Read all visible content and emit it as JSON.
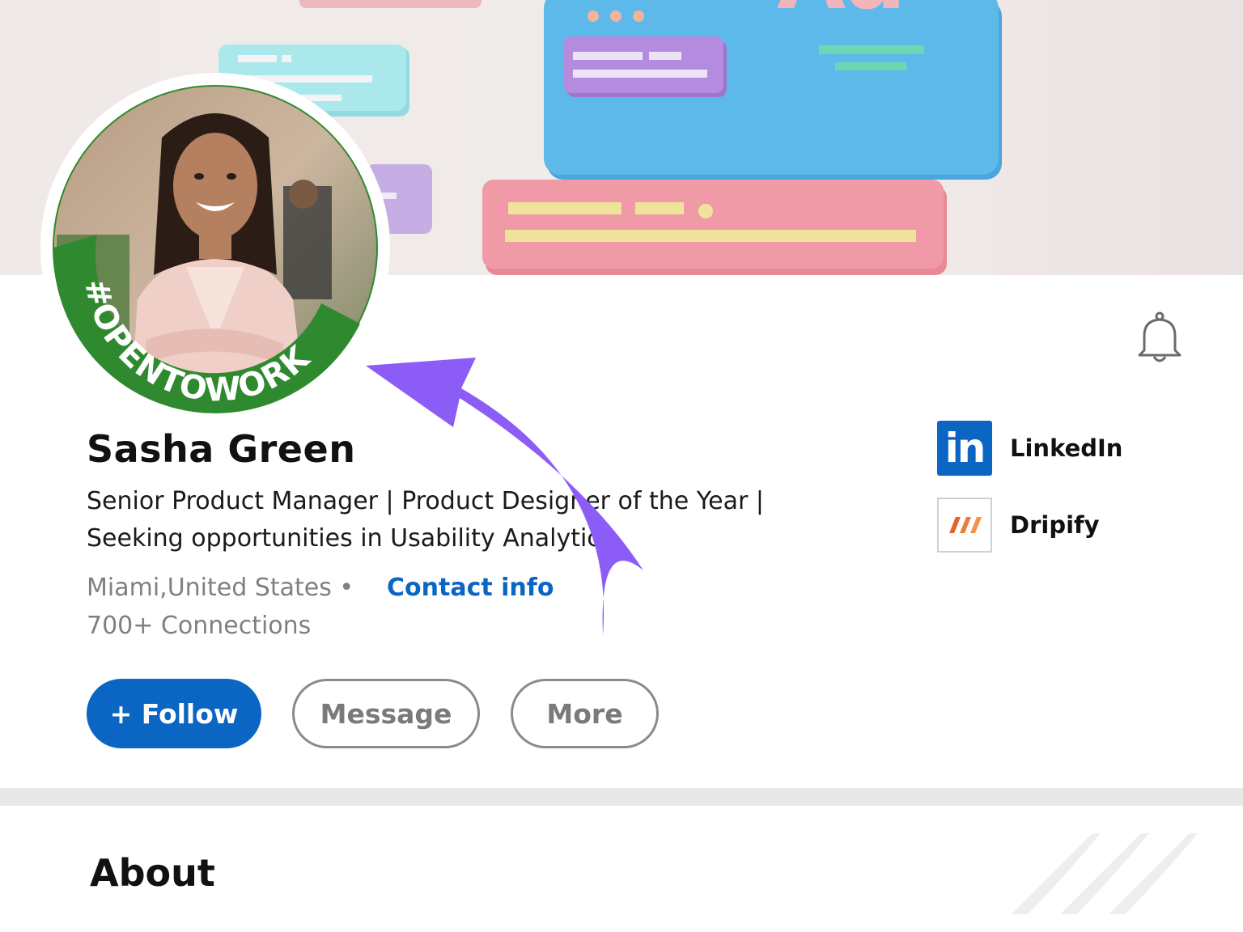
{
  "colors": {
    "accent": "#0a66c2",
    "open_to_work": "#2e8b32",
    "arrow": "#8b5cf6"
  },
  "profile": {
    "badge": "#OPENTOWORK",
    "name": "Sasha Green",
    "headline_lines": [
      "Senior Product Manager | Product Designer of the Year |",
      "Seeking opportunities in Usability Analytics"
    ],
    "location": "Miami,United States •",
    "contact_label": "Contact info",
    "connections": "700+ Connections"
  },
  "actions": {
    "follow": "+ Follow",
    "message": "Message",
    "more": "More"
  },
  "links": [
    {
      "label": "LinkedIn",
      "logo_text": "in",
      "icon": "linkedin-logo"
    },
    {
      "label": "Dripify",
      "icon": "dripify-logo"
    }
  ],
  "about": {
    "title": "About"
  },
  "icons": {
    "bell": "bell-icon"
  }
}
